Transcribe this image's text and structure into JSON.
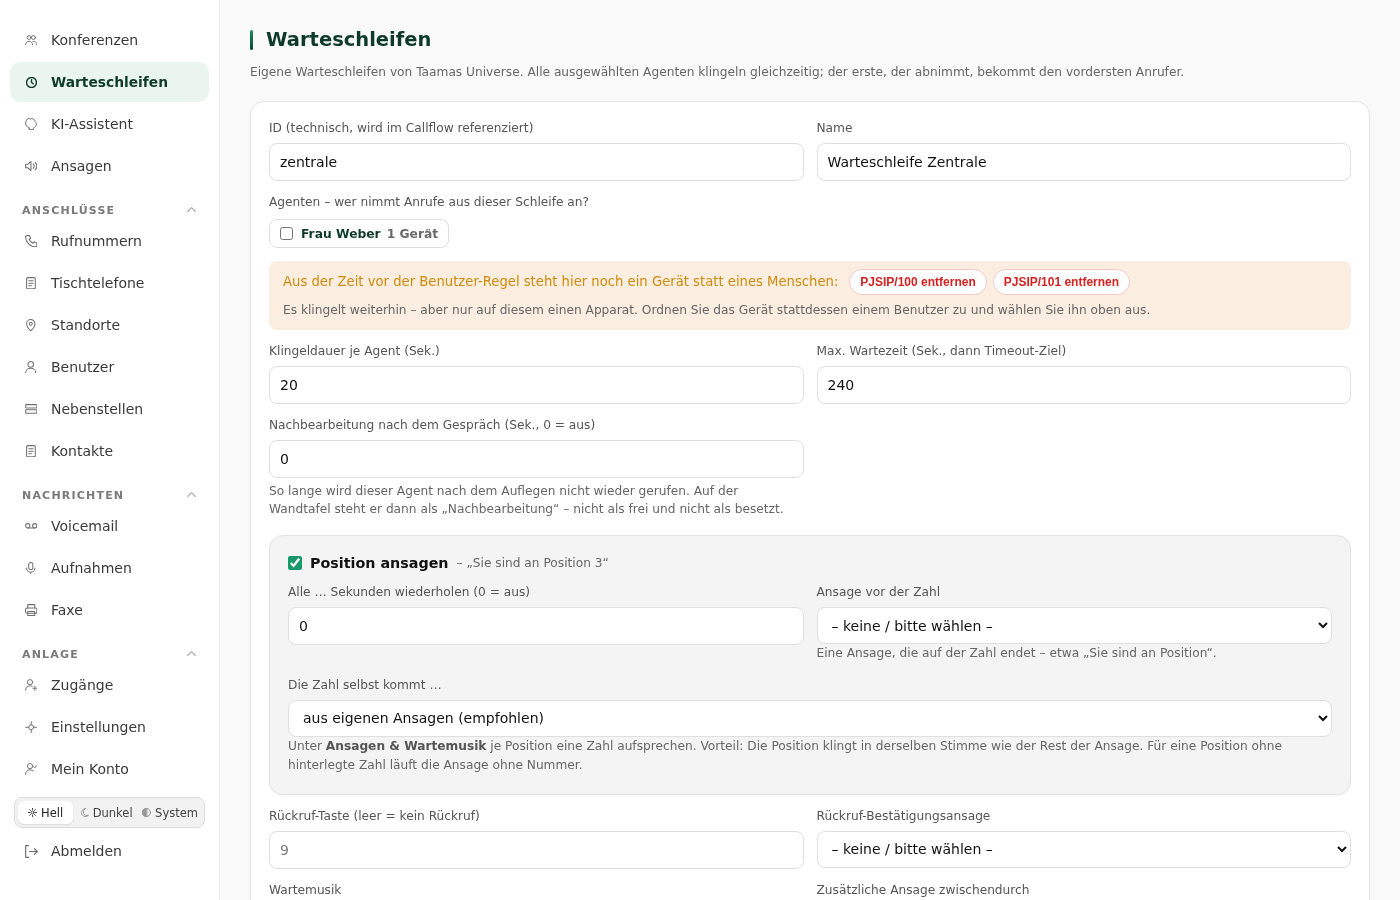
{
  "sidebar": {
    "groups": [
      {
        "items": [
          {
            "label": "Konferenzen",
            "selected": false
          },
          {
            "label": "Warteschleifen",
            "selected": true
          },
          {
            "label": "KI-Assistent",
            "selected": false
          },
          {
            "label": "Ansagen",
            "selected": false
          }
        ]
      },
      {
        "heading": "ANSCHLÜSSE",
        "expanded": true,
        "items": [
          {
            "label": "Rufnummern",
            "selected": false
          },
          {
            "label": "Tischtelefone",
            "selected": false
          },
          {
            "label": "Standorte",
            "selected": false
          },
          {
            "label": "Benutzer",
            "selected": false
          },
          {
            "label": "Nebenstellen",
            "selected": false
          },
          {
            "label": "Kontakte",
            "selected": false
          }
        ]
      },
      {
        "heading": "NACHRICHTEN",
        "expanded": true,
        "items": [
          {
            "label": "Voicemail",
            "selected": false
          },
          {
            "label": "Aufnahmen",
            "selected": false
          },
          {
            "label": "Faxe",
            "selected": false
          }
        ]
      },
      {
        "heading": "ANLAGE",
        "expanded": true,
        "items": [
          {
            "label": "Zugänge",
            "selected": false
          },
          {
            "label": "Einstellungen",
            "selected": false
          },
          {
            "label": "Mein Konto",
            "selected": false
          }
        ]
      }
    ],
    "theme_switch": [
      {
        "label": "Hell",
        "selected": true
      },
      {
        "label": "Dunkel",
        "selected": false
      },
      {
        "label": "System",
        "selected": false
      }
    ],
    "logout": "Abmelden"
  },
  "page": {
    "title": "Warteschleifen",
    "subtitle": "Eigene Warteschleifen von Taamas Universe. Alle ausgewählten Agenten klingeln gleichzeitig; der erste, der abnimmt, bekommt den vordersten Anrufer."
  },
  "form": {
    "rows": [
      {
        "kind": "columns",
        "fields": [
          {
            "label": "ID (technisch, wird im Callflow referenziert)",
            "kind": "text",
            "value": "zentrale"
          },
          {
            "label": "Name",
            "kind": "text",
            "value": "Warteschleife Zentrale"
          }
        ]
      },
      {
        "kind": "agents",
        "label": "Agenten – wer nimmt Anrufe aus dieser Schleife an?",
        "agents": [
          {
            "name": "Frau Weber",
            "devices": "1 Gerät",
            "checked": false
          }
        ]
      },
      {
        "kind": "warning",
        "text": "Aus der Zeit vor der Benutzer-Regel steht hier noch ein Gerät statt eines Menschen:",
        "actions": [
          "PJSIP/100 entfernen",
          "PJSIP/101 entfernen"
        ],
        "detail": "Es klingelt weiterhin – aber nur auf diesem einen Apparat. Ordnen Sie das Gerät stattdessen einem Benutzer zu und wählen Sie ihn oben aus."
      },
      {
        "kind": "columns",
        "fields": [
          {
            "label": "Klingeldauer je Agent (Sek.)",
            "kind": "text",
            "value": "20"
          },
          {
            "label": "Max. Wartezeit (Sek., dann Timeout-Ziel)",
            "kind": "text",
            "value": "240"
          }
        ]
      },
      {
        "kind": "columns",
        "fields": [
          {
            "label": "Nachbearbeitung nach dem Gespräch (Sek., 0 = aus)",
            "kind": "text",
            "value": "0",
            "hint": "So lange wird dieser Agent nach dem Auflegen nicht wieder gerufen. Auf der Wandtafel steht er dann als „Nachbearbeitung“ – nicht als frei und nicht als besetzt."
          }
        ]
      },
      {
        "kind": "panel",
        "checked": true,
        "title": "Position ansagen",
        "note": "– „Sie sind an Position 3“",
        "rows": [
          {
            "kind": "columns",
            "fields": [
              {
                "label": "Alle … Sekunden wiederholen (0 = aus)",
                "kind": "text",
                "value": "0"
              },
              {
                "label": "Ansage vor der Zahl",
                "kind": "select",
                "value": "– keine / bitte wählen –",
                "hint": "Eine Ansage, die auf der Zahl endet – etwa „Sie sind an Position“."
              }
            ]
          },
          {
            "kind": "full",
            "fields": [
              {
                "label": "Die Zahl selbst kommt …",
                "kind": "select",
                "value": "aus eigenen Ansagen (empfohlen)",
                "hint": "Unter **Ansagen & Wartemusik** je Position eine Zahl aufsprechen. Vorteil: Die Position klingt in derselben Stimme wie der Rest der Ansage. Für eine Position ohne hinterlegte Zahl läuft die Ansage ohne Nummer."
              }
            ]
          }
        ]
      },
      {
        "kind": "columns",
        "fields": [
          {
            "label": "Rückruf-Taste (leer = kein Rückruf)",
            "kind": "text",
            "placeholder": "9"
          },
          {
            "label": "Rückruf-Bestätigungsansage",
            "kind": "select",
            "value": "– keine / bitte wählen –"
          }
        ]
      },
      {
        "kind": "columns",
        "fields": [
          {
            "label": "Wartemusik"
          },
          {
            "label": "Zusätzliche Ansage zwischendurch"
          }
        ]
      }
    ]
  }
}
